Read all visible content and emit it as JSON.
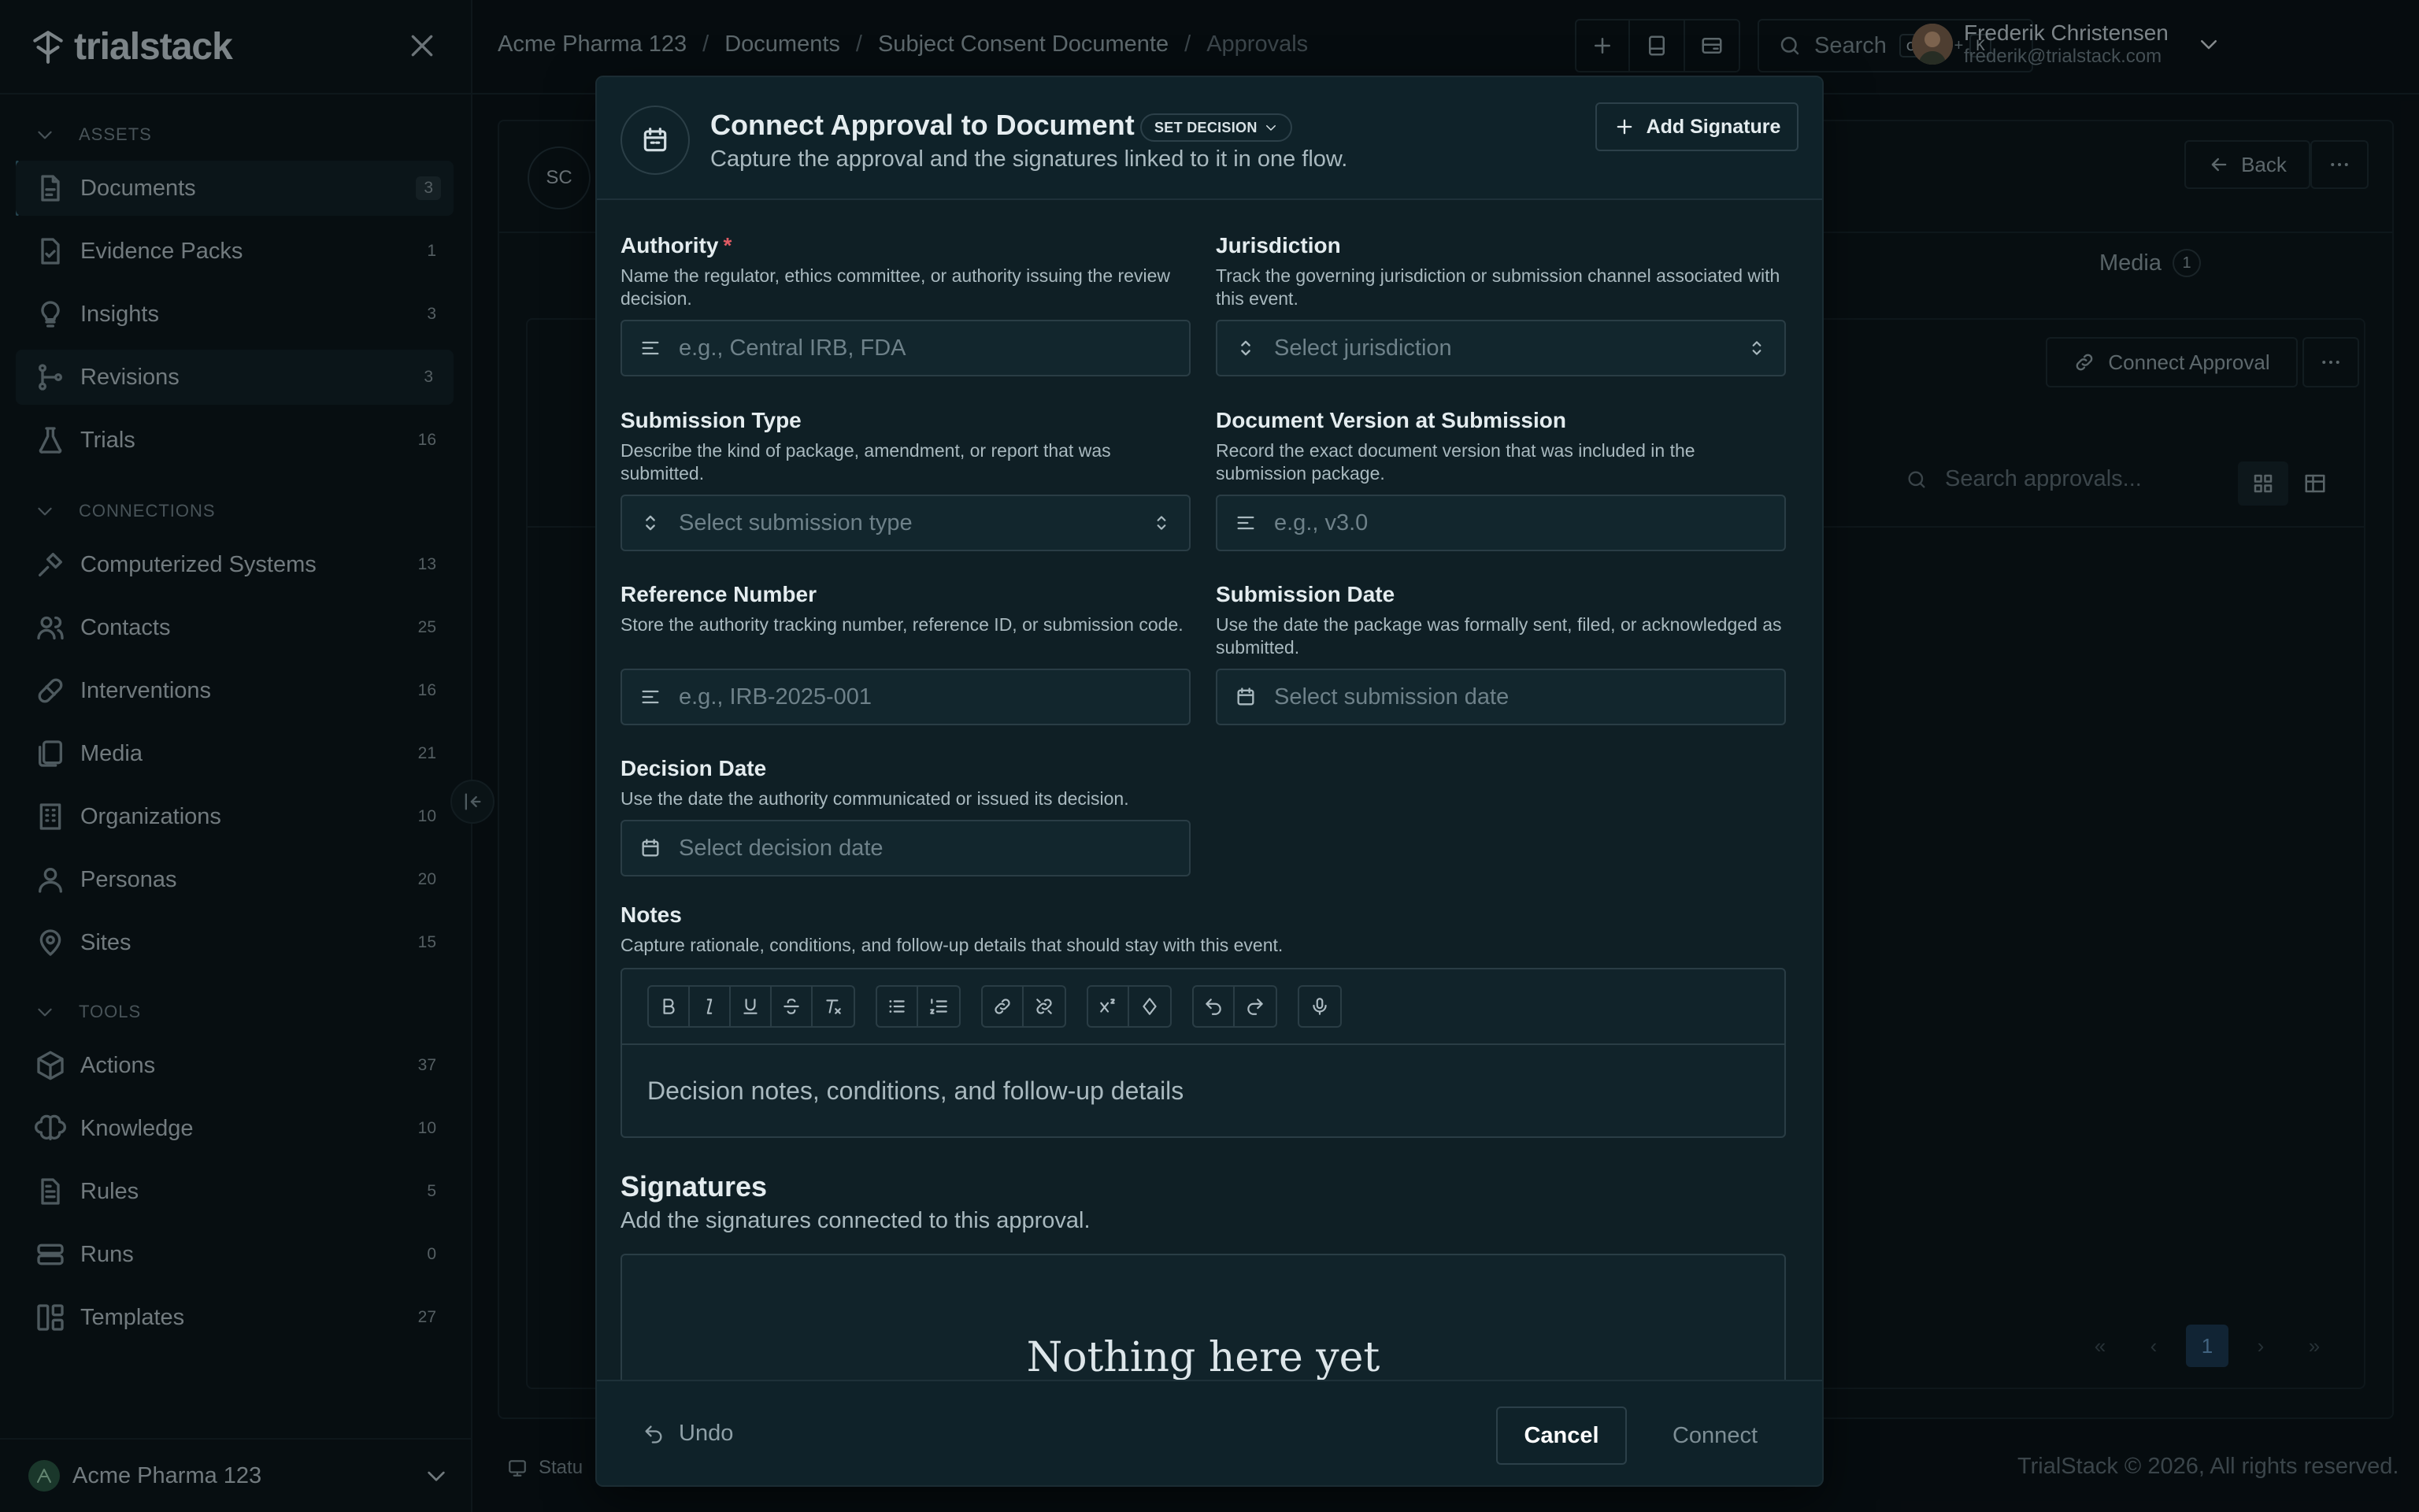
{
  "app": {
    "name": "trialstack"
  },
  "breadcrumbs": [
    "Acme Pharma 123",
    "Documents",
    "Subject Consent Documente",
    "Approvals"
  ],
  "search": {
    "label": "Search",
    "kbd1": "ctrl",
    "plus": "+",
    "kbd2": "K"
  },
  "user": {
    "name": "Frederik Christensen",
    "email": "frederik@trialstack.com"
  },
  "sidebar": {
    "sections": {
      "assets": "ASSETS",
      "connections": "CONNECTIONS",
      "tools": "TOOLS"
    },
    "items": [
      {
        "label": "Documents",
        "count": "3",
        "icon": "document-icon"
      },
      {
        "label": "Evidence Packs",
        "count": "1",
        "icon": "evidence-pack-icon"
      },
      {
        "label": "Insights",
        "count": "3",
        "icon": "lightbulb-icon"
      },
      {
        "label": "Revisions",
        "count": "3",
        "icon": "revisions-icon"
      },
      {
        "label": "Trials",
        "count": "16",
        "icon": "flask-icon"
      },
      {
        "label": "Computerized Systems",
        "count": "13",
        "icon": "system-icon"
      },
      {
        "label": "Contacts",
        "count": "25",
        "icon": "contacts-icon"
      },
      {
        "label": "Interventions",
        "count": "16",
        "icon": "pill-icon"
      },
      {
        "label": "Media",
        "count": "21",
        "icon": "media-icon"
      },
      {
        "label": "Organizations",
        "count": "10",
        "icon": "building-icon"
      },
      {
        "label": "Personas",
        "count": "20",
        "icon": "person-icon"
      },
      {
        "label": "Sites",
        "count": "15",
        "icon": "location-pin-icon"
      },
      {
        "label": "Actions",
        "count": "37",
        "icon": "actions-icon"
      },
      {
        "label": "Knowledge",
        "count": "10",
        "icon": "knowledge-icon"
      },
      {
        "label": "Rules",
        "count": "5",
        "icon": "rules-icon"
      },
      {
        "label": "Runs",
        "count": "0",
        "icon": "runs-icon"
      },
      {
        "label": "Templates",
        "count": "27",
        "icon": "templates-icon"
      }
    ],
    "workspace": "Acme Pharma 123"
  },
  "background": {
    "avatar": "SC",
    "back": "Back",
    "media_tab": "Media",
    "media_count": "1",
    "connect_approval": "Connect Approval",
    "search_placeholder": "Search approvals...",
    "page": "1",
    "status": "Statu",
    "footer": "TrialStack © 2026, All rights reserved."
  },
  "modal": {
    "title": "Connect Approval to Document",
    "badge": "SET DECISION",
    "subtitle": "Capture the approval and the signatures linked to it in one flow.",
    "add_signature": "Add Signature",
    "fields": {
      "authority": {
        "label": "Authority",
        "required": "*",
        "desc": "Name the regulator, ethics committee, or authority issuing the review decision.",
        "placeholder": "e.g., Central IRB, FDA"
      },
      "jurisdiction": {
        "label": "Jurisdiction",
        "desc": "Track the governing jurisdiction or submission channel associated with this event.",
        "placeholder": "Select jurisdiction"
      },
      "submission_type": {
        "label": "Submission Type",
        "desc": "Describe the kind of package, amendment, or report that was submitted.",
        "placeholder": "Select submission type"
      },
      "doc_version": {
        "label": "Document Version at Submission",
        "desc": "Record the exact document version that was included in the submission package.",
        "placeholder": "e.g., v3.0"
      },
      "reference": {
        "label": "Reference Number",
        "desc": "Store the authority tracking number, reference ID, or submission code.",
        "placeholder": "e.g., IRB-2025-001"
      },
      "submission_date": {
        "label": "Submission Date",
        "desc": "Use the date the package was formally sent, filed, or acknowledged as submitted.",
        "placeholder": "Select submission date"
      },
      "decision_date": {
        "label": "Decision Date",
        "desc": "Use the date the authority communicated or issued its decision.",
        "placeholder": "Select decision date"
      }
    },
    "notes": {
      "label": "Notes",
      "desc": "Capture rationale, conditions, and follow-up details that should stay with this event.",
      "placeholder": "Decision notes, conditions, and follow-up details"
    },
    "signatures": {
      "title": "Signatures",
      "subtitle": "Add the signatures connected to this approval.",
      "empty": "Nothing here yet"
    },
    "footer": {
      "undo": "Undo",
      "cancel": "Cancel",
      "connect": "Connect"
    }
  }
}
